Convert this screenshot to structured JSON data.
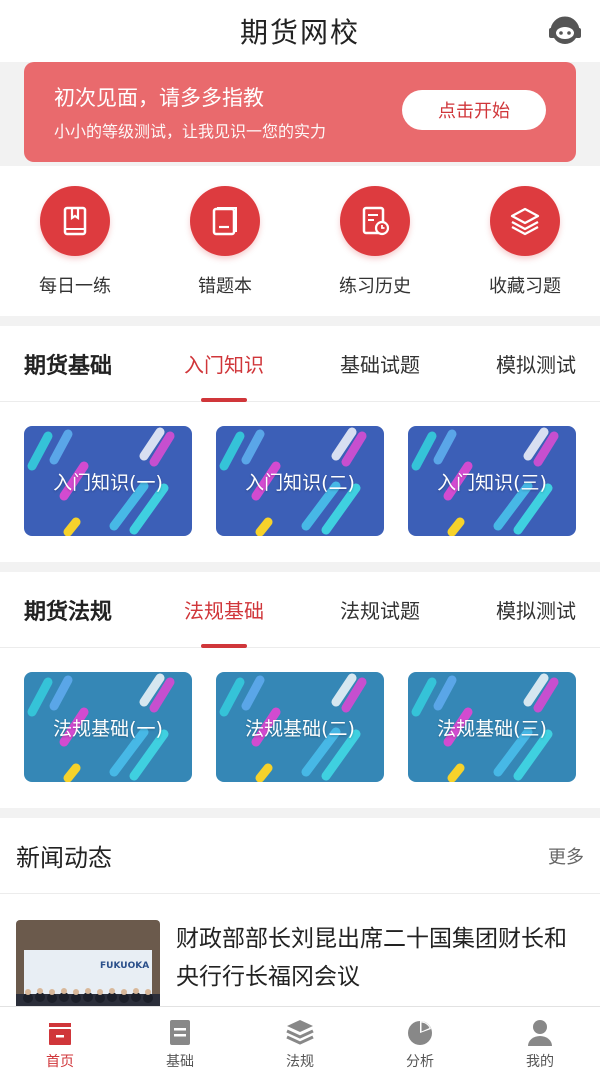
{
  "header": {
    "title": "期货网校",
    "service_icon": "customer-service-icon"
  },
  "banner": {
    "title": "初次见面，请多多指教",
    "subtitle": "小小的等级测试，让我见识一您的实力",
    "button_label": "点击开始",
    "color": "#e96a6d"
  },
  "quick_actions": [
    {
      "label": "每日一练",
      "icon": "book-icon"
    },
    {
      "label": "错题本",
      "icon": "notebook-icon"
    },
    {
      "label": "练习历史",
      "icon": "history-icon"
    },
    {
      "label": "收藏习题",
      "icon": "layers-icon"
    }
  ],
  "sections": [
    {
      "title": "期货基础",
      "tabs": [
        "入门知识",
        "基础试题",
        "模拟测试"
      ],
      "active_tab": 0,
      "cards": [
        "入门知识(一)",
        "入门知识(二)",
        "入门知识(三)"
      ]
    },
    {
      "title": "期货法规",
      "tabs": [
        "法规基础",
        "法规试题",
        "模拟测试"
      ],
      "active_tab": 0,
      "cards": [
        "法规基础(一)",
        "法规基础(二)",
        "法规基础(三)"
      ]
    }
  ],
  "news": {
    "title": "新闻动态",
    "more_label": "更多",
    "items": [
      {
        "headline": "财政部部长刘昆出席二十国集团财长和央行行长福冈会议",
        "thumb_text": "FUKUOKA"
      }
    ]
  },
  "tabbar": {
    "active": 0,
    "items": [
      {
        "label": "首页",
        "icon": "home-icon"
      },
      {
        "label": "基础",
        "icon": "list-icon"
      },
      {
        "label": "法规",
        "icon": "stack-icon"
      },
      {
        "label": "分析",
        "icon": "pie-chart-icon"
      },
      {
        "label": "我的",
        "icon": "user-icon"
      }
    ]
  },
  "colors": {
    "accent": "#d0363a",
    "card_blue": "#3c5fb7",
    "card_teal": "#3587b6"
  }
}
